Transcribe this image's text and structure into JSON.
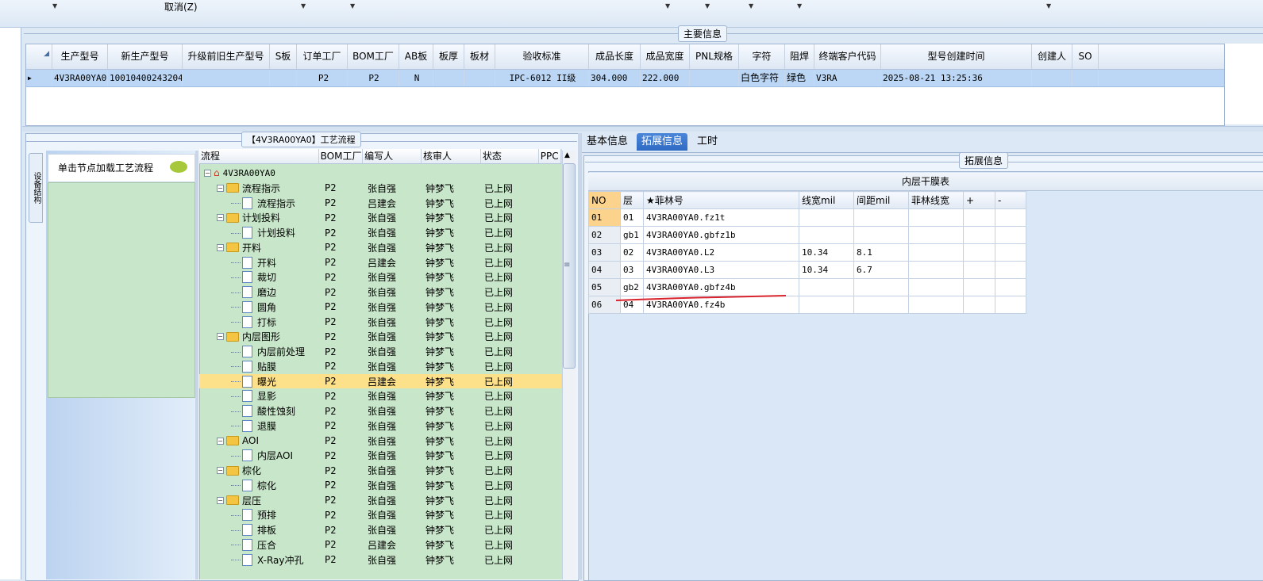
{
  "toolbar": {
    "cancel_label": "取消(Z)"
  },
  "main_info": {
    "group_label": "主要信息",
    "columns": [
      "生产型号",
      "新生产型号",
      "升级前旧生产型号",
      "S板",
      "订单工厂",
      "BOM工厂",
      "AB板",
      "板厚",
      "板材",
      "验收标准",
      "成品长度",
      "成品宽度",
      "PNL规格",
      "字符",
      "阻焊",
      "终端客户代码",
      "型号创建时间",
      "创建人",
      "SO"
    ],
    "row": [
      "4V3RA00YA0",
      "10010400243204",
      "",
      "",
      "P2",
      "P2",
      "N",
      "",
      "",
      "IPC-6012 II级",
      "304.000",
      "222.000",
      "",
      "白色字符",
      "绿色",
      "V3RA",
      "2025-08-21 13:25:36",
      "",
      ""
    ]
  },
  "process": {
    "group_label": "【4V3RA00YA0】工艺流程",
    "side_tab": "设备结构",
    "nav_hint": "单击节点加载工艺流程",
    "columns": [
      "流程",
      "BOM工厂",
      "编写人",
      "核审人",
      "状态",
      "PPC"
    ],
    "root": "4V3RA00YA0",
    "rows": [
      {
        "name": "流程指示",
        "level": 1,
        "bom": "P2",
        "writer": "张自强",
        "reviewer": "钟梦飞",
        "status": "已上网"
      },
      {
        "name": "流程指示",
        "level": 2,
        "bom": "P2",
        "writer": "吕建会",
        "reviewer": "钟梦飞",
        "status": "已上网"
      },
      {
        "name": "计划投料",
        "level": 1,
        "bom": "P2",
        "writer": "张自强",
        "reviewer": "钟梦飞",
        "status": "已上网"
      },
      {
        "name": "计划投料",
        "level": 2,
        "bom": "P2",
        "writer": "张自强",
        "reviewer": "钟梦飞",
        "status": "已上网"
      },
      {
        "name": "开料",
        "level": 1,
        "bom": "P2",
        "writer": "张自强",
        "reviewer": "钟梦飞",
        "status": "已上网"
      },
      {
        "name": "开料",
        "level": 2,
        "bom": "P2",
        "writer": "吕建会",
        "reviewer": "钟梦飞",
        "status": "已上网"
      },
      {
        "name": "裁切",
        "level": 2,
        "bom": "P2",
        "writer": "张自强",
        "reviewer": "钟梦飞",
        "status": "已上网"
      },
      {
        "name": "磨边",
        "level": 2,
        "bom": "P2",
        "writer": "张自强",
        "reviewer": "钟梦飞",
        "status": "已上网"
      },
      {
        "name": "圆角",
        "level": 2,
        "bom": "P2",
        "writer": "张自强",
        "reviewer": "钟梦飞",
        "status": "已上网"
      },
      {
        "name": "打标",
        "level": 2,
        "bom": "P2",
        "writer": "张自强",
        "reviewer": "钟梦飞",
        "status": "已上网"
      },
      {
        "name": "内层图形",
        "level": 1,
        "bom": "P2",
        "writer": "张自强",
        "reviewer": "钟梦飞",
        "status": "已上网"
      },
      {
        "name": "内层前处理",
        "level": 2,
        "bom": "P2",
        "writer": "张自强",
        "reviewer": "钟梦飞",
        "status": "已上网"
      },
      {
        "name": "贴膜",
        "level": 2,
        "bom": "P2",
        "writer": "张自强",
        "reviewer": "钟梦飞",
        "status": "已上网"
      },
      {
        "name": "曝光",
        "level": 2,
        "bom": "P2",
        "writer": "吕建会",
        "reviewer": "钟梦飞",
        "status": "已上网"
      },
      {
        "name": "显影",
        "level": 2,
        "bom": "P2",
        "writer": "张自强",
        "reviewer": "钟梦飞",
        "status": "已上网"
      },
      {
        "name": "酸性蚀刻",
        "level": 2,
        "bom": "P2",
        "writer": "张自强",
        "reviewer": "钟梦飞",
        "status": "已上网"
      },
      {
        "name": "退膜",
        "level": 2,
        "bom": "P2",
        "writer": "张自强",
        "reviewer": "钟梦飞",
        "status": "已上网"
      },
      {
        "name": "AOI",
        "level": 1,
        "bom": "P2",
        "writer": "张自强",
        "reviewer": "钟梦飞",
        "status": "已上网"
      },
      {
        "name": "内层AOI",
        "level": 2,
        "bom": "P2",
        "writer": "张自强",
        "reviewer": "钟梦飞",
        "status": "已上网"
      },
      {
        "name": "棕化",
        "level": 1,
        "bom": "P2",
        "writer": "张自强",
        "reviewer": "钟梦飞",
        "status": "已上网"
      },
      {
        "name": "棕化",
        "level": 2,
        "bom": "P2",
        "writer": "张自强",
        "reviewer": "钟梦飞",
        "status": "已上网"
      },
      {
        "name": "层压",
        "level": 1,
        "bom": "P2",
        "writer": "张自强",
        "reviewer": "钟梦飞",
        "status": "已上网"
      },
      {
        "name": "预排",
        "level": 2,
        "bom": "P2",
        "writer": "张自强",
        "reviewer": "钟梦飞",
        "status": "已上网"
      },
      {
        "name": "排板",
        "level": 2,
        "bom": "P2",
        "writer": "张自强",
        "reviewer": "钟梦飞",
        "status": "已上网"
      },
      {
        "name": "压合",
        "level": 2,
        "bom": "P2",
        "writer": "吕建会",
        "reviewer": "钟梦飞",
        "status": "已上网"
      },
      {
        "name": "X-Ray冲孔",
        "level": 2,
        "bom": "P2",
        "writer": "张自强",
        "reviewer": "钟梦飞",
        "status": "已上网"
      }
    ]
  },
  "right": {
    "tabs": [
      "基本信息",
      "拓展信息",
      "工时"
    ],
    "group_label": "拓展信息",
    "table_title": "内层干膜表",
    "columns": [
      "NO",
      "层",
      "★菲林号",
      "线宽mil",
      "间距mil",
      "菲林线宽",
      "+",
      "-"
    ],
    "rows": [
      [
        "01",
        "01",
        "4V3RA00YA0.fz1t",
        "",
        "",
        "",
        "",
        ""
      ],
      [
        "02",
        "gb1",
        "4V3RA00YA0.gbfz1b",
        "",
        "",
        "",
        "",
        ""
      ],
      [
        "03",
        "02",
        "4V3RA00YA0.L2",
        "10.34",
        "8.1",
        "",
        "",
        ""
      ],
      [
        "04",
        "03",
        "4V3RA00YA0.L3",
        "10.34",
        "6.7",
        "",
        "",
        ""
      ],
      [
        "05",
        "gb2",
        "4V3RA00YA0.gbfz4b",
        "",
        "",
        "",
        "",
        ""
      ],
      [
        "06",
        "04",
        "4V3RA00YA0.fz4b",
        "",
        "",
        "",
        "",
        ""
      ]
    ]
  }
}
